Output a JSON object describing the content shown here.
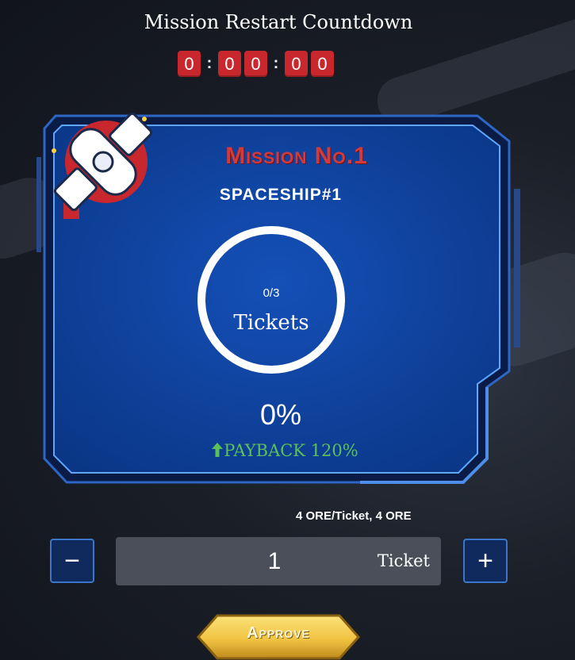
{
  "header": {
    "title": "Mission Restart Countdown"
  },
  "countdown": {
    "d1": "0",
    "d2": "0",
    "d3": "0",
    "d4": "0",
    "d5": "0",
    "sep": ":"
  },
  "card": {
    "mission_title": "Mission No.1",
    "ship_name": "SPACESHIP#1",
    "ticket_count": "0/3",
    "ticket_label": "Tickets",
    "percent": "0%",
    "payback": "PAYBACK 120%"
  },
  "purchase": {
    "price": "4 ORE/Ticket, 4 ORE",
    "minus_label": "−",
    "plus_label": "+",
    "quantity": "1",
    "unit": "Ticket",
    "approve_label": "Approve"
  },
  "colors": {
    "accent_red": "#c8282d",
    "card_blue": "#0c3f94",
    "payback_green": "#5cc05a",
    "button_gold": "#f1c443"
  },
  "icons": {
    "ship": "satellite-icon",
    "payback": "arrow-up-icon"
  }
}
